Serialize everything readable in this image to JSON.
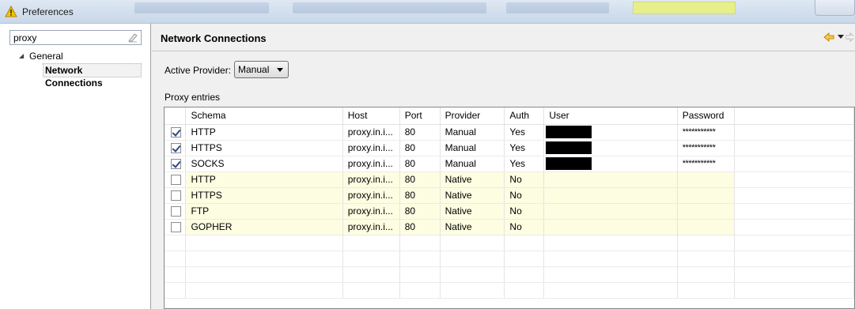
{
  "window": {
    "title": "Preferences",
    "icon": "warning-triangle-icon"
  },
  "left": {
    "search_value": "proxy",
    "tree": {
      "parent": "General",
      "child": "Network Connections"
    }
  },
  "page": {
    "title": "Network Connections",
    "provider_label": "Active Provider:",
    "provider_value": "Manual",
    "entries_label": "Proxy entries"
  },
  "table": {
    "columns": [
      "Schema",
      "Host",
      "Port",
      "Provider",
      "Auth",
      "User",
      "Password"
    ],
    "rows": [
      {
        "checked": true,
        "schema": "HTTP",
        "host": "proxy.in.i...",
        "port": "80",
        "provider": "Manual",
        "auth": "Yes",
        "user_redacted": true,
        "password": "***********"
      },
      {
        "checked": true,
        "schema": "HTTPS",
        "host": "proxy.in.i...",
        "port": "80",
        "provider": "Manual",
        "auth": "Yes",
        "user_redacted": true,
        "password": "***********"
      },
      {
        "checked": true,
        "schema": "SOCKS",
        "host": "proxy.in.i...",
        "port": "80",
        "provider": "Manual",
        "auth": "Yes",
        "user_redacted": true,
        "password": "***********"
      },
      {
        "checked": false,
        "schema": "HTTP",
        "host": "proxy.in.i...",
        "port": "80",
        "provider": "Native",
        "auth": "No",
        "user_redacted": false,
        "password": ""
      },
      {
        "checked": false,
        "schema": "HTTPS",
        "host": "proxy.in.i...",
        "port": "80",
        "provider": "Native",
        "auth": "No",
        "user_redacted": false,
        "password": ""
      },
      {
        "checked": false,
        "schema": "FTP",
        "host": "proxy.in.i...",
        "port": "80",
        "provider": "Native",
        "auth": "No",
        "user_redacted": false,
        "password": ""
      },
      {
        "checked": false,
        "schema": "GOPHER",
        "host": "proxy.in.i...",
        "port": "80",
        "provider": "Native",
        "auth": "No",
        "user_redacted": false,
        "password": ""
      }
    ]
  },
  "colors": {
    "native_row_bg": "#fdfde2",
    "redaction": "#000000",
    "warning_icon": "#f5c400",
    "back_arrow": "#e8a317"
  }
}
